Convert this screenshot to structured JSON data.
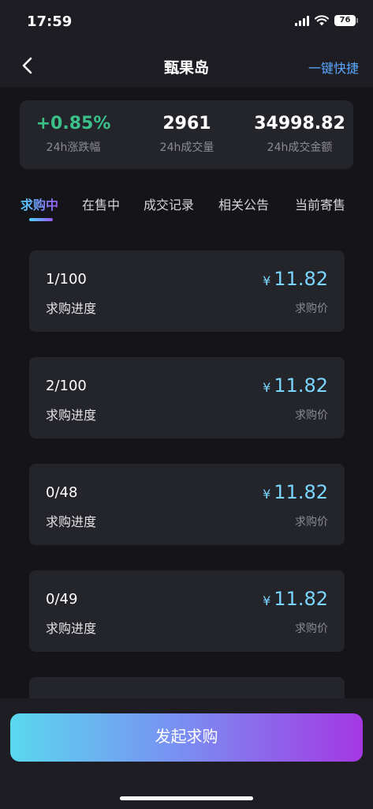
{
  "status_bar": {
    "time": "17:59",
    "battery": "76",
    "icons": [
      "signal-icon",
      "wifi-icon",
      "battery-icon"
    ]
  },
  "nav": {
    "back_icon": "chevron-left-icon",
    "title": "甄果岛",
    "action": "一键快捷"
  },
  "stats": [
    {
      "value": "+0.85%",
      "label": "24h涨跌幅",
      "color": "#3cc08a"
    },
    {
      "value": "2961",
      "label": "24h成交量"
    },
    {
      "value": "34998.82",
      "label": "24h成交金额"
    }
  ],
  "tabs": [
    "求购中",
    "在售中",
    "成交记录",
    "相关公告",
    "当前寄售"
  ],
  "active_tab": "求购中",
  "listings": [
    {
      "progress": "1/100",
      "progress_label": "求购进度",
      "currency": "¥",
      "price": "11.82",
      "price_label": "求购价"
    },
    {
      "progress": "2/100",
      "progress_label": "求购进度",
      "currency": "¥",
      "price": "11.82",
      "price_label": "求购价"
    },
    {
      "progress": "0/48",
      "progress_label": "求购进度",
      "currency": "¥",
      "price": "11.82",
      "price_label": "求购价"
    },
    {
      "progress": "0/49",
      "progress_label": "求购进度",
      "currency": "¥",
      "price": "11.82",
      "price_label": "求购价"
    }
  ],
  "cta": "发起求购",
  "colors": {
    "accent_blue": "#7ad6ff",
    "positive": "#3cc08a",
    "link": "#5aa8ff",
    "gradient_start": "#5ad8ee",
    "gradient_end": "#a437e3"
  }
}
